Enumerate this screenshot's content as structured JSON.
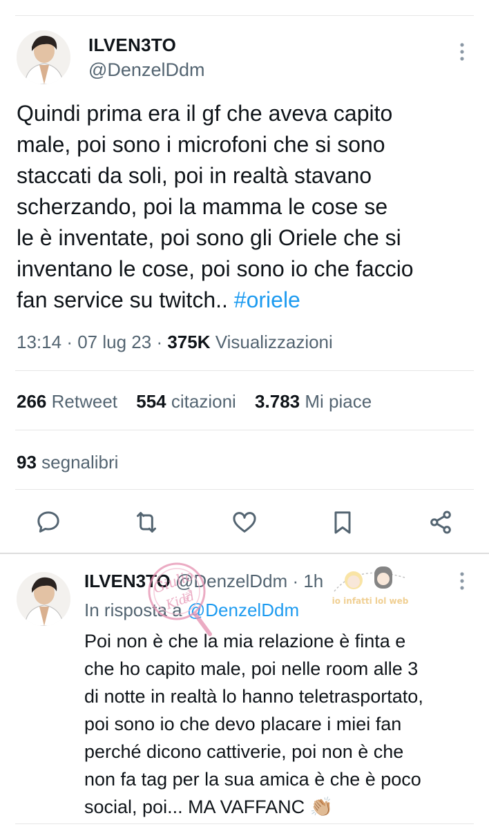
{
  "tweet": {
    "author_name": "ILVEN3TO",
    "author_handle": "@DenzelDdm",
    "text_lines": [
      "Quindi prima era il gf che aveva capito",
      "male, poi sono i microfoni che si sono",
      "staccati da soli, poi in realtà stavano",
      "scherzando, poi la mamma le cose se",
      "le è inventate, poi sono gli Oriele che si",
      "inventano le cose, poi sono io che faccio",
      "fan service su twitch.. "
    ],
    "hashtag": "#oriele",
    "time": "13:14",
    "date": "07 lug 23",
    "views_count": "375K",
    "views_label": "Visualizzazioni",
    "sep": "·"
  },
  "stats": {
    "retweets_count": "266",
    "retweets_label": "Retweet",
    "quotes_count": "554",
    "quotes_label": "citazioni",
    "likes_count": "3.783",
    "likes_label": "Mi piace",
    "bookmarks_count": "93",
    "bookmarks_label": "segnalibri"
  },
  "reply": {
    "author_name": "ILVEN3TO",
    "author_handle": "@DenzelDdm",
    "time": "1h",
    "reply_prefix": "In risposta a",
    "reply_to_handle": "@DenzelDdm",
    "text_lines": [
      "Poi non è che la mia relazione è finta e",
      "che ho capito male, poi nelle room alle 3",
      "di notte in realtà lo hanno teletrasportato,",
      "poi sono io che devo placare i miei fan",
      "perché dicono cattiverie, poi non è che",
      "non fa tag per la sua amica è che è poco",
      "social, poi... MA VAFFANC 👏🏼"
    ]
  },
  "watermark": {
    "text": "Giulio della Kidd",
    "blog_text": "io infatti lol web"
  },
  "colors": {
    "accent": "#1d9bf0",
    "secondary_text": "#536471",
    "divider": "#e6e6e6",
    "watermark_pink": "#e58fb0"
  }
}
